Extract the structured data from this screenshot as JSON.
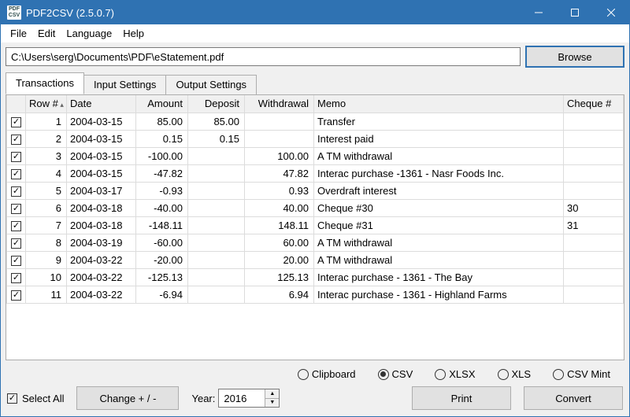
{
  "window": {
    "title": "PDF2CSV (2.5.0.7)"
  },
  "menubar": {
    "items": [
      "File",
      "Edit",
      "Language",
      "Help"
    ]
  },
  "pathbar": {
    "path": "C:\\Users\\serg\\Documents\\PDF\\eStatement.pdf",
    "browse": "Browse"
  },
  "tabs": {
    "items": [
      "Transactions",
      "Input Settings",
      "Output Settings"
    ],
    "active": 0
  },
  "grid": {
    "columns": [
      "",
      "Row #",
      "Date",
      "Amount",
      "Deposit",
      "Withdrawal",
      "Memo",
      "Cheque #"
    ],
    "rows": [
      {
        "row": 1,
        "date": "2004-03-15",
        "amount": "85.00",
        "deposit": "85.00",
        "withdrawal": "",
        "memo": "Transfer",
        "cheque": ""
      },
      {
        "row": 2,
        "date": "2004-03-15",
        "amount": "0.15",
        "deposit": "0.15",
        "withdrawal": "",
        "memo": "Interest paid",
        "cheque": ""
      },
      {
        "row": 3,
        "date": "2004-03-15",
        "amount": "-100.00",
        "deposit": "",
        "withdrawal": "100.00",
        "memo": "A TM withdrawal",
        "cheque": ""
      },
      {
        "row": 4,
        "date": "2004-03-15",
        "amount": "-47.82",
        "deposit": "",
        "withdrawal": "47.82",
        "memo": "Interac purchase -1361 - Nasr Foods Inc.",
        "cheque": ""
      },
      {
        "row": 5,
        "date": "2004-03-17",
        "amount": "-0.93",
        "deposit": "",
        "withdrawal": "0.93",
        "memo": "Overdraft interest",
        "cheque": ""
      },
      {
        "row": 6,
        "date": "2004-03-18",
        "amount": "-40.00",
        "deposit": "",
        "withdrawal": "40.00",
        "memo": "Cheque #30",
        "cheque": "30"
      },
      {
        "row": 7,
        "date": "2004-03-18",
        "amount": "-148.11",
        "deposit": "",
        "withdrawal": "148.11",
        "memo": "Cheque #31",
        "cheque": "31"
      },
      {
        "row": 8,
        "date": "2004-03-19",
        "amount": "-60.00",
        "deposit": "",
        "withdrawal": "60.00",
        "memo": "A TM withdrawal",
        "cheque": ""
      },
      {
        "row": 9,
        "date": "2004-03-22",
        "amount": "-20.00",
        "deposit": "",
        "withdrawal": "20.00",
        "memo": "A TM withdrawal",
        "cheque": ""
      },
      {
        "row": 10,
        "date": "2004-03-22",
        "amount": "-125.13",
        "deposit": "",
        "withdrawal": "125.13",
        "memo": "Interac purchase - 1361 - The Bay",
        "cheque": ""
      },
      {
        "row": 11,
        "date": "2004-03-22",
        "amount": "-6.94",
        "deposit": "",
        "withdrawal": "6.94",
        "memo": "Interac purchase - 1361 - Highland Farms",
        "cheque": ""
      }
    ]
  },
  "formats": {
    "options": [
      "Clipboard",
      "CSV",
      "XLSX",
      "XLS",
      "CSV Mint"
    ],
    "selected": 1
  },
  "bottom": {
    "select_all": "Select All",
    "change_btn": "Change + / -",
    "year_label": "Year:",
    "year_value": "2016",
    "print": "Print",
    "convert": "Convert"
  }
}
